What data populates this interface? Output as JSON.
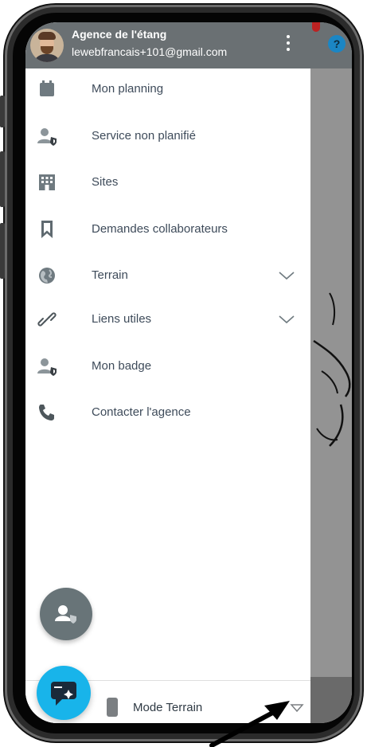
{
  "user": {
    "agency_name": "Agence de l'étang",
    "email": "lewebfrancais+101@gmail.com"
  },
  "menu": [
    {
      "label": "Mon planning",
      "icon": "calendar-icon"
    },
    {
      "label": "Service non planifié",
      "icon": "person-shield-icon"
    },
    {
      "label": "Sites",
      "icon": "building-icon"
    },
    {
      "label": "Demandes collaborateurs",
      "icon": "bookmark-icon"
    },
    {
      "label": "Terrain",
      "icon": "globe-icon",
      "expandable": true
    },
    {
      "label": "Liens utiles",
      "icon": "link-icon",
      "expandable": true
    },
    {
      "label": "Mon badge",
      "icon": "person-shield-icon"
    },
    {
      "label": "Contacter l'agence",
      "icon": "phone-icon"
    }
  ],
  "bottom_bar": {
    "mode_label": "Mode Terrain"
  },
  "colors": {
    "header": "#6a7073",
    "accent": "#18b4ea",
    "menu_text": "#3e4b5a",
    "icon": "#6f7a80"
  }
}
